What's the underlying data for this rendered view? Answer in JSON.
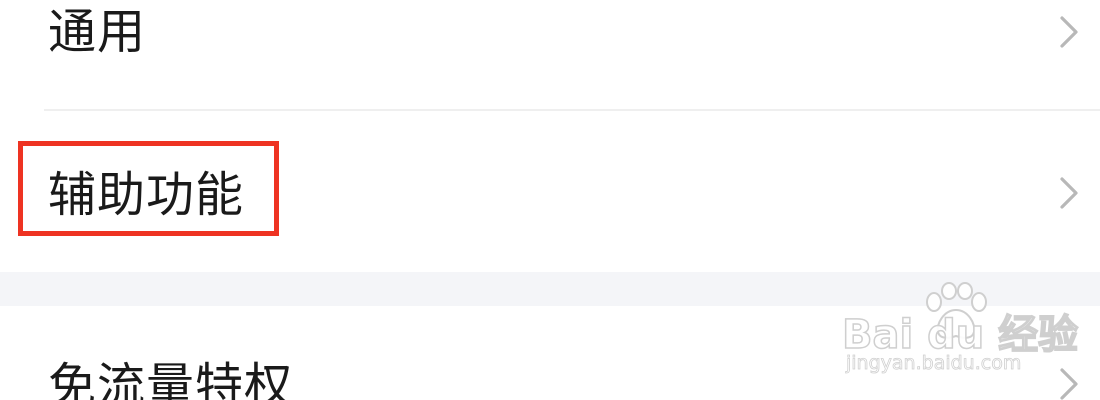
{
  "settings": {
    "items": [
      {
        "label": "通用",
        "icon": "chevron-right-icon"
      },
      {
        "label": "辅助功能",
        "icon": "chevron-right-icon",
        "highlighted": true
      },
      {
        "label": "免流量特权",
        "icon": "chevron-right-icon"
      }
    ]
  },
  "annotation": {
    "highlight_color": "#ee3322"
  },
  "watermark": {
    "logo_text": "Bai du 经验",
    "url": "jingyan.baidu.com"
  },
  "colors": {
    "background": "#ffffff",
    "section_gap": "#f4f5f8",
    "divider": "#efefef",
    "text": "#1a1a1a",
    "chevron": "#b8b8b8"
  }
}
